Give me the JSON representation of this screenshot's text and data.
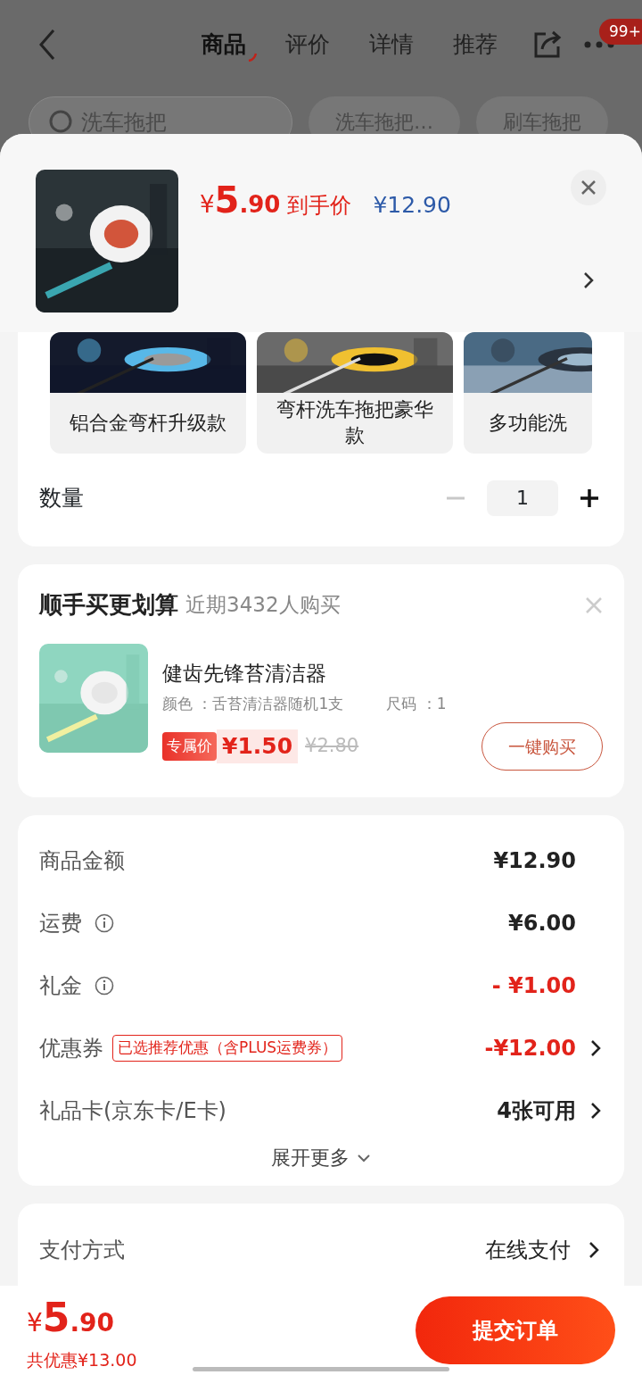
{
  "nav": {
    "tabs": [
      {
        "label": "商品",
        "selected": true
      },
      {
        "label": "评价",
        "selected": false
      },
      {
        "label": "详情",
        "selected": false
      },
      {
        "label": "推荐",
        "selected": false
      }
    ],
    "badge": "99+"
  },
  "search": {
    "placeholder": "洗车拖把",
    "chips": [
      "洗车拖把…",
      "刷车拖把"
    ]
  },
  "product": {
    "price": {
      "symbol": "¥",
      "integer": "5",
      "decimal": ".90"
    },
    "price_label": "到手价",
    "original_price": "¥12.90"
  },
  "options": [
    {
      "label": "铝合金弯杆升级款",
      "selected": false
    },
    {
      "label": "弯杆洗车拖把豪华款",
      "selected": false
    },
    {
      "label": "多功能洗",
      "selected": false
    }
  ],
  "quantity": {
    "label": "数量",
    "value": "1",
    "minus_disabled": true
  },
  "combo": {
    "title": "顺手买更划算",
    "subtitle": "近期3432人购买",
    "item": {
      "name": "健齿先锋苔清洁器",
      "color_spec": "颜色 ：舌苔清洁器随机1支",
      "size_spec": "尺码 ：1",
      "tag": "专属价",
      "price": "¥1.50",
      "old_price": "¥2.80",
      "button": "一键购买"
    }
  },
  "summary": {
    "rows": [
      {
        "label": "商品金额",
        "info": false,
        "value": "¥12.90",
        "negative": false,
        "arrow": false
      },
      {
        "label": "运费",
        "info": true,
        "value": "¥6.00",
        "negative": false,
        "arrow": false
      },
      {
        "label": "礼金",
        "info": true,
        "value": "- ¥1.00",
        "negative": true,
        "arrow": false
      },
      {
        "label": "优惠券",
        "info": false,
        "tag": "已选推荐优惠（含PLUS运费券）",
        "value": "-¥12.00",
        "negative": true,
        "arrow": true
      },
      {
        "label": "礼品卡(京东卡/E卡)",
        "info": false,
        "value": "4张可用",
        "negative": false,
        "arrow": true
      }
    ],
    "more": "展开更多"
  },
  "payment": {
    "label": "支付方式",
    "value": "在线支付"
  },
  "footer": {
    "price": {
      "symbol": "¥",
      "integer": "5",
      "decimal": ".90"
    },
    "saving": "共优惠¥13.00",
    "submit": "提交订单"
  }
}
